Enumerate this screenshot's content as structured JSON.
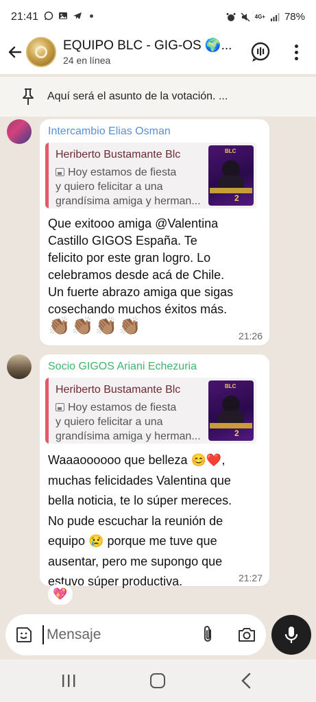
{
  "status_bar": {
    "time": "21:41",
    "network": "4G+",
    "battery": "78%"
  },
  "header": {
    "title": "EQUIPO BLC - GIG-OS 🌍...",
    "subtitle": "24 en línea"
  },
  "pinned": {
    "text": "Aquí será el asunto de la votación. ..."
  },
  "messages": [
    {
      "sender": "Intercambio Elias Osman",
      "sender_color": "#5a8fd6",
      "quote_author": "Heriberto Bustamante Blc",
      "quote_lines": [
        "Hoy estamos de fiesta",
        "y quiero felicitar a una",
        "grandísima amiga y herman..."
      ],
      "text_lines": [
        "Que exitooo amiga @Valentina",
        "Castillo GIGOS España. Te",
        "felicito por este gran logro. Lo",
        "celebramos desde acá de Chile.",
        "Un fuerte abrazo amiga que sigas",
        "cosechando muchos éxitos más."
      ],
      "emojis": "👏🏽👏🏽👏🏽👏🏽",
      "time": "21:26"
    },
    {
      "sender": "Socio GIGOS Ariani Echezuria",
      "sender_color": "#3fb56a",
      "quote_author": "Heriberto Bustamante Blc",
      "quote_lines": [
        "Hoy estamos de fiesta",
        "y quiero felicitar a una",
        "grandísima amiga y herman..."
      ],
      "text_lines": [
        "Waaaoooooo que belleza 😊❤️,",
        "muchas felicidades Valentina que",
        "bella noticia, te lo súper mereces.",
        "No pude escuchar la reunión de",
        "equipo 😢 porque me tuve que",
        "ausentar, pero me supongo que",
        "estuvo súper productiva."
      ],
      "time": "21:27",
      "reaction": "💖"
    }
  ],
  "thumbnail": {
    "logo": "BLC",
    "number": "2"
  },
  "composer": {
    "placeholder": "Mensaje"
  },
  "colors": {
    "chat_bg": "#ece5dd",
    "quote_bar": "#e05a67",
    "quote_author": "#6d2a33",
    "mic_button": "#1f1f1f"
  }
}
